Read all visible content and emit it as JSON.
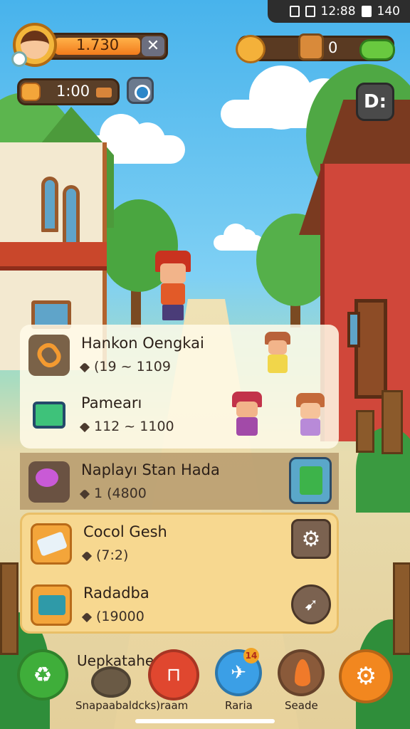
{
  "status_bar": {
    "time": "12:88",
    "battery": "140"
  },
  "hud": {
    "xp_value": "1.730",
    "xp_progress": 0.75,
    "close_label": "✕",
    "timer": "1:00",
    "resource_count": "0",
    "menu_label": "D:"
  },
  "quests": [
    {
      "title": "Hankon Oengkai",
      "meta": "(19 ~ 1109",
      "icon": "key-icon"
    },
    {
      "title": "Pamearı",
      "meta": "112 ~ 1100",
      "icon": "chest-icon"
    },
    {
      "title": "Naplayı Stan Hada",
      "meta": "1 (4800",
      "icon": "potion-icon"
    },
    {
      "title": "Cocol Gesh",
      "meta": "(7:2)",
      "icon": "eraser-icon"
    },
    {
      "title": "Radadba",
      "meta": "(19000",
      "icon": "box-icon"
    }
  ],
  "side_buttons": [
    "book-icon",
    "gear-icon",
    "rocket-icon"
  ],
  "bottom": {
    "label": "Uepkatahe",
    "nav": [
      {
        "icon": "recycle-icon",
        "color": "#3fae3a",
        "label": ""
      },
      {
        "icon": "pet-icon",
        "color": "#6a5a45",
        "label": "Snapaabaldcks)raam"
      },
      {
        "icon": "bridge-icon",
        "color": "#e0472f",
        "label": ""
      },
      {
        "icon": "plane-icon",
        "color": "#3b9fe6",
        "label": "Raria",
        "badge": "14"
      },
      {
        "icon": "leaf-icon",
        "color": "#8a5a3a",
        "label": "Seade"
      },
      {
        "icon": "settings-icon",
        "color": "#f2871f",
        "label": ""
      }
    ]
  }
}
